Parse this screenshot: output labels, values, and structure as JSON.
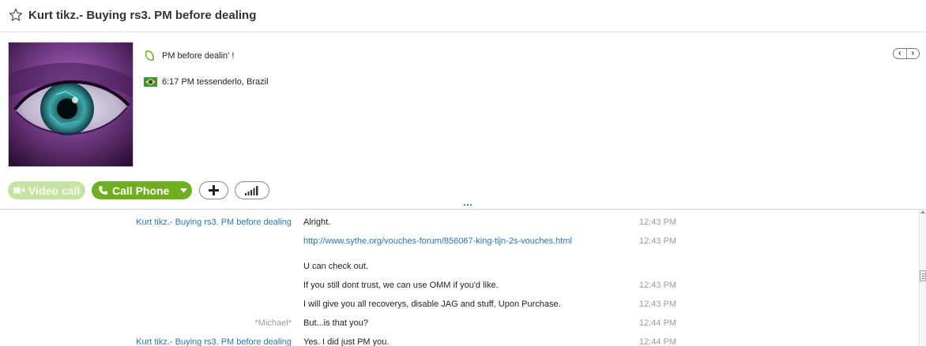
{
  "header": {
    "title": "Kurt tikz.- Buying rs3. PM before dealing"
  },
  "profile": {
    "mood": "PM before dealin' !",
    "location": "6:17 PM tessenderlo, Brazil"
  },
  "actions": {
    "video_label": "Video call",
    "call_label": "Call Phone"
  },
  "messages": [
    {
      "sender": "Kurt tikz.- Buying rs3. PM before dealing",
      "sender_type": "other",
      "text": "Alright.",
      "time": "12:43 PM",
      "is_link": false
    },
    {
      "sender": "",
      "sender_type": "other",
      "text": "http://www.sythe.org/vouches-forum/856067-king-tijn-2s-vouches.html",
      "time": "12:43 PM",
      "is_link": true
    },
    {
      "sender": "",
      "sender_type": "other",
      "text": "U can check out.",
      "time": "",
      "is_link": false
    },
    {
      "sender": "",
      "sender_type": "other",
      "text": "If you still dont trust, we can use OMM if you'd like.",
      "time": "12:43 PM",
      "is_link": false
    },
    {
      "sender": "",
      "sender_type": "other",
      "text": "I will give you all recoverys, disable JAG and stuff, Upon Purchase.",
      "time": "12:43 PM",
      "is_link": false
    },
    {
      "sender": "*Michael*",
      "sender_type": "me",
      "text": "But...is that you?",
      "time": "12:44 PM",
      "is_link": false
    },
    {
      "sender": "Kurt tikz.- Buying rs3. PM before dealing",
      "sender_type": "other",
      "text": "Yes. I did just PM you.",
      "time": "12:44 PM",
      "is_link": false
    }
  ]
}
